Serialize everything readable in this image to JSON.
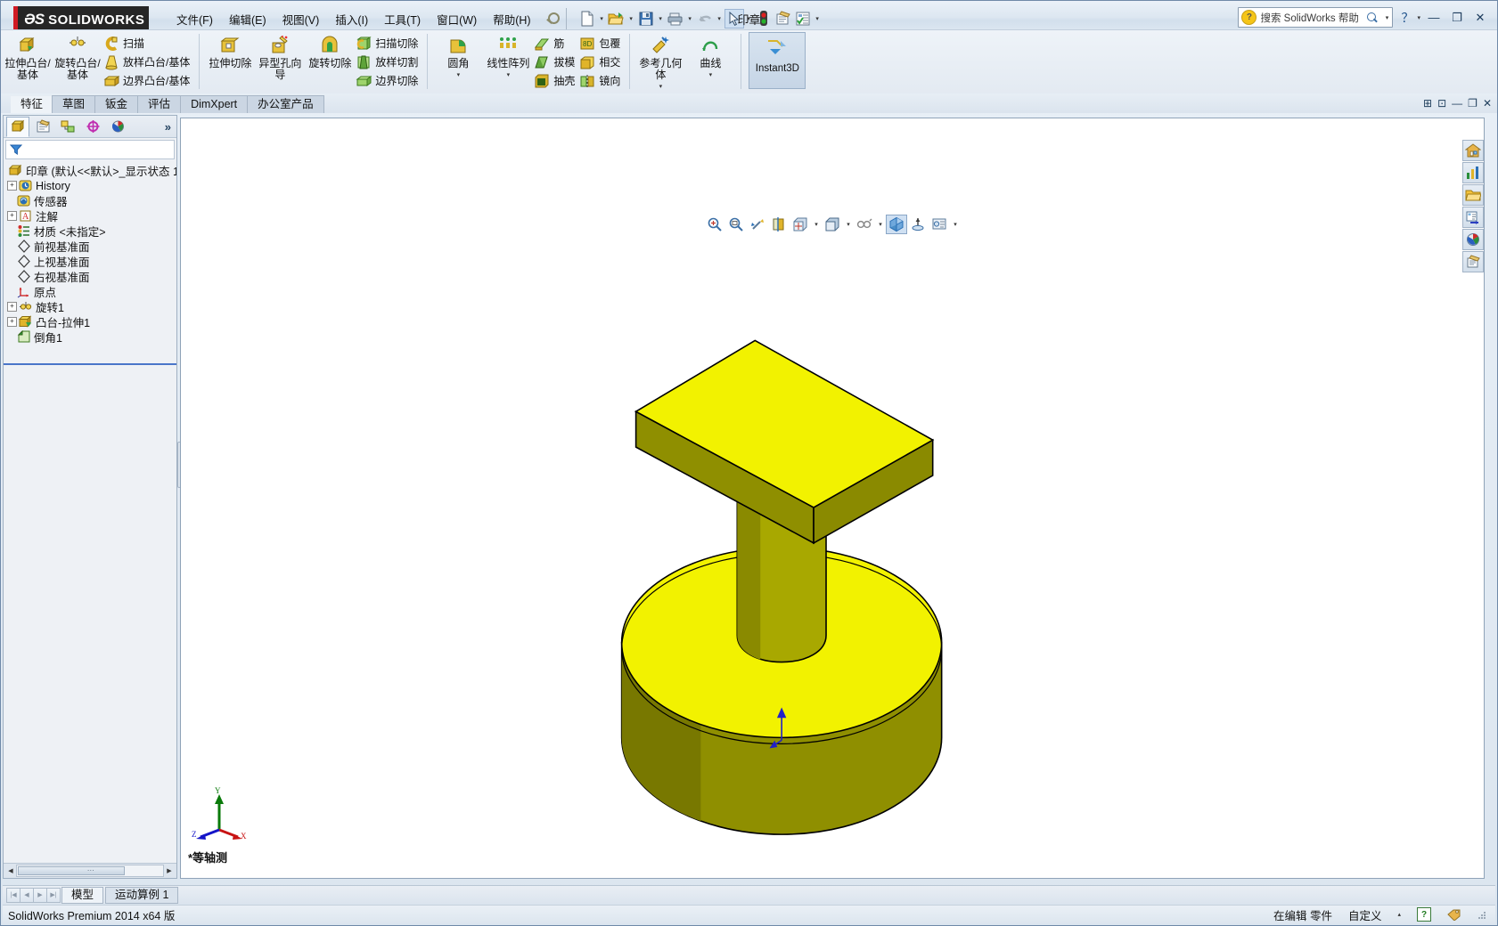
{
  "app": {
    "brand_ds": "ƏS",
    "brand_name": "SOLIDWORKS",
    "document_title": "印章",
    "status_product": "SolidWorks Premium 2014 x64 版"
  },
  "menubar": {
    "items": [
      {
        "label": "文件(F)",
        "name": "menu-file"
      },
      {
        "label": "编辑(E)",
        "name": "menu-edit"
      },
      {
        "label": "视图(V)",
        "name": "menu-view"
      },
      {
        "label": "插入(I)",
        "name": "menu-insert"
      },
      {
        "label": "工具(T)",
        "name": "menu-tools"
      },
      {
        "label": "窗口(W)",
        "name": "menu-window"
      },
      {
        "label": "帮助(H)",
        "name": "menu-help"
      }
    ]
  },
  "quick_access": {
    "icons": [
      {
        "name": "new-document-icon",
        "has_caret": true
      },
      {
        "name": "open-folder-icon",
        "has_caret": true
      },
      {
        "name": "save-icon",
        "has_caret": true
      },
      {
        "name": "print-icon",
        "has_caret": true
      },
      {
        "name": "undo-icon",
        "has_caret": true
      },
      {
        "name": "select-arrow-icon",
        "has_caret": true,
        "selected": true
      },
      {
        "name": "rebuild-traffic-light-icon",
        "has_caret": false
      },
      {
        "name": "options-icon",
        "has_caret": false
      },
      {
        "name": "properties-icon",
        "has_caret": true
      }
    ]
  },
  "search": {
    "placeholder": "搜索 SolidWorks 帮助",
    "icon": "help-question-icon",
    "magnifier": "magnifier-icon"
  },
  "window_controls": {
    "help": "?",
    "minimize": "—",
    "restore": "❐",
    "close": "✕"
  },
  "ribbon": {
    "groups": [
      {
        "name": "features-boss-group",
        "big": [
          {
            "label": "拉伸凸台/基体",
            "icon": "extrude-boss-icon",
            "name": "extruded-boss-base"
          },
          {
            "label": "旋转凸台/基体",
            "icon": "revolve-boss-icon",
            "name": "revolved-boss-base"
          }
        ],
        "small": [
          {
            "label": "扫描",
            "icon": "sweep-icon",
            "name": "swept-boss-base"
          },
          {
            "label": "放样凸台/基体",
            "icon": "loft-icon",
            "name": "lofted-boss-base"
          },
          {
            "label": "边界凸台/基体",
            "icon": "boundary-icon",
            "name": "boundary-boss-base"
          }
        ]
      },
      {
        "name": "features-cut-group",
        "big": [
          {
            "label": "拉伸切除",
            "icon": "extrude-cut-icon",
            "name": "extruded-cut"
          },
          {
            "label": "异型孔向导",
            "icon": "hole-wizard-icon",
            "name": "hole-wizard"
          },
          {
            "label": "旋转切除",
            "icon": "revolve-cut-icon",
            "name": "revolved-cut"
          }
        ],
        "small": [
          {
            "label": "扫描切除",
            "icon": "sweep-cut-icon",
            "name": "swept-cut"
          },
          {
            "label": "放样切割",
            "icon": "loft-cut-icon",
            "name": "lofted-cut"
          },
          {
            "label": "边界切除",
            "icon": "boundary-cut-icon",
            "name": "boundary-cut"
          }
        ]
      },
      {
        "name": "features-modify-group",
        "big": [
          {
            "label": "圆角",
            "icon": "fillet-icon",
            "name": "fillet",
            "caret": true
          },
          {
            "label": "线性阵列",
            "icon": "linear-pattern-icon",
            "name": "linear-pattern",
            "caret": true
          }
        ],
        "small": [
          {
            "label": "筋",
            "icon": "rib-icon",
            "name": "rib"
          },
          {
            "label": "拔模",
            "icon": "draft-icon",
            "name": "draft"
          },
          {
            "label": "抽壳",
            "icon": "shell-icon",
            "name": "shell"
          }
        ],
        "small2": [
          {
            "label": "包覆",
            "icon": "wrap-icon",
            "name": "wrap"
          },
          {
            "label": "相交",
            "icon": "intersect-icon",
            "name": "intersect"
          },
          {
            "label": "镜向",
            "icon": "mirror-icon",
            "name": "mirror"
          }
        ]
      },
      {
        "name": "features-reference-group",
        "big": [
          {
            "label": "参考几何体",
            "icon": "reference-geometry-icon",
            "name": "reference-geometry",
            "caret": true
          },
          {
            "label": "曲线",
            "icon": "curves-icon",
            "name": "curves",
            "caret": true
          }
        ]
      }
    ],
    "instant3d": {
      "label": "Instant3D",
      "icon": "instant3d-icon",
      "name": "instant3d-toggle",
      "active": true
    }
  },
  "command_tabs": [
    {
      "label": "特征",
      "name": "tab-features",
      "active": true
    },
    {
      "label": "草图",
      "name": "tab-sketch",
      "active": false
    },
    {
      "label": "钣金",
      "name": "tab-sheetmetal",
      "active": false
    },
    {
      "label": "评估",
      "name": "tab-evaluate",
      "active": false
    },
    {
      "label": "DimXpert",
      "name": "tab-dimxpert",
      "active": false
    },
    {
      "label": "办公室产品",
      "name": "tab-office-products",
      "active": false
    }
  ],
  "feature_manager": {
    "tabs": [
      {
        "name": "tab-feature-manager-tree",
        "icon": "feature-tree-icon",
        "active": true
      },
      {
        "name": "tab-property-manager",
        "icon": "property-manager-icon",
        "active": false
      },
      {
        "name": "tab-configuration-manager",
        "icon": "configuration-manager-icon",
        "active": false
      },
      {
        "name": "tab-dimxpert-manager",
        "icon": "dimxpert-manager-icon",
        "active": false
      },
      {
        "name": "tab-display-manager",
        "icon": "display-manager-icon",
        "active": false
      }
    ],
    "more": "»",
    "filter": {
      "icon": "filter-funnel-icon",
      "value": ""
    },
    "tree": [
      {
        "label": "印章  (默认<<默认>_显示状态 1",
        "icon": "part-icon",
        "expandable": false,
        "level": 0,
        "name": "tree-root-part"
      },
      {
        "label": "History",
        "icon": "history-icon",
        "expandable": true,
        "level": 1,
        "name": "tree-history"
      },
      {
        "label": "传感器",
        "icon": "sensor-icon",
        "expandable": false,
        "level": 1,
        "name": "tree-sensors"
      },
      {
        "label": "注解",
        "icon": "annotations-icon",
        "expandable": true,
        "level": 1,
        "name": "tree-annotations"
      },
      {
        "label": "材质 <未指定>",
        "icon": "material-icon",
        "expandable": false,
        "level": 1,
        "name": "tree-material"
      },
      {
        "label": "前视基准面",
        "icon": "plane-icon",
        "expandable": false,
        "level": 1,
        "name": "tree-front-plane"
      },
      {
        "label": "上视基准面",
        "icon": "plane-icon",
        "expandable": false,
        "level": 1,
        "name": "tree-top-plane"
      },
      {
        "label": "右视基准面",
        "icon": "plane-icon",
        "expandable": false,
        "level": 1,
        "name": "tree-right-plane"
      },
      {
        "label": "原点",
        "icon": "origin-icon",
        "expandable": false,
        "level": 1,
        "name": "tree-origin"
      },
      {
        "label": "旋转1",
        "icon": "revolve-feature-icon",
        "expandable": true,
        "level": 1,
        "name": "tree-revolve1"
      },
      {
        "label": "凸台-拉伸1",
        "icon": "extrude-feature-icon",
        "expandable": true,
        "level": 1,
        "name": "tree-boss-extrude1"
      },
      {
        "label": "倒角1",
        "icon": "chamfer-feature-icon",
        "expandable": false,
        "level": 1,
        "name": "tree-chamfer1"
      }
    ]
  },
  "view_toolbar": [
    {
      "name": "zoom-to-fit-icon",
      "caret": false
    },
    {
      "name": "zoom-to-area-icon",
      "caret": false
    },
    {
      "name": "previous-view-icon",
      "caret": false
    },
    {
      "name": "section-view-icon",
      "caret": false
    },
    {
      "name": "view-orientation-icon",
      "caret": true
    },
    {
      "name": "display-style-icon",
      "caret": true
    },
    {
      "name": "hide-show-items-icon",
      "caret": true
    },
    {
      "name": "apply-scene-icon",
      "caret": false,
      "selected": true
    },
    {
      "name": "view-settings-icon",
      "caret": false
    },
    {
      "name": "display-pane-icon",
      "caret": true
    }
  ],
  "right_toolbar": [
    {
      "name": "home-icon"
    },
    {
      "name": "solidworks-resources-icon"
    },
    {
      "name": "design-library-icon"
    },
    {
      "name": "file-explorer-icon"
    },
    {
      "name": "appearances-scenes-icon"
    },
    {
      "name": "custom-properties-icon"
    }
  ],
  "graphics": {
    "view_label": "*等轴测",
    "triad": {
      "x": "X",
      "y": "Y",
      "z": "Z"
    },
    "model": {
      "color_top": "#f2f200",
      "color_side": "#8a8a00",
      "color_mid": "#b5b500",
      "edge": "#000000"
    }
  },
  "bottom_tabs": [
    {
      "label": "模型",
      "name": "tab-model",
      "active": true
    },
    {
      "label": "运动算例 1",
      "name": "tab-motion-study-1",
      "active": false
    }
  ],
  "statusbar": {
    "left": "SolidWorks Premium 2014 x64 版",
    "editing": "在编辑 零件",
    "custom": "自定义",
    "help_badge": "?",
    "tag_icon": "tag-icon"
  }
}
